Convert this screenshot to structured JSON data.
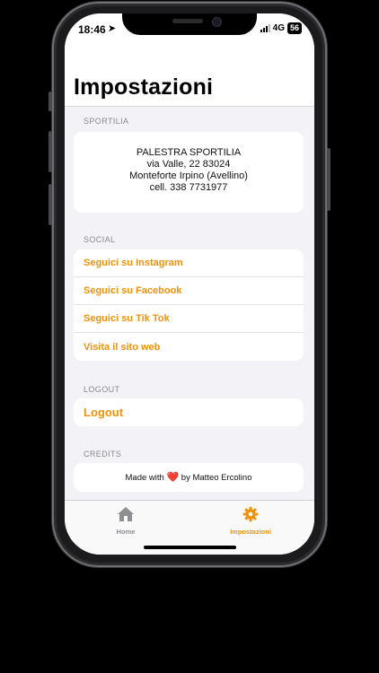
{
  "status": {
    "time": "18:46",
    "location_icon": "location-arrow-icon",
    "network": "4G",
    "battery": "56"
  },
  "page": {
    "title": "Impostazioni"
  },
  "sections": {
    "sportilia": {
      "header": "SPORTILIA",
      "lines": [
        "PALESTRA SPORTILIA",
        "via Valle, 22 83024",
        "Monteforte Irpino (Avellino)",
        "cell. 338 7731977"
      ]
    },
    "social": {
      "header": "SOCIAL",
      "items": [
        {
          "label": "Seguici su Instagram"
        },
        {
          "label": "Seguici su Facebook"
        },
        {
          "label": "Seguici su Tik Tok"
        },
        {
          "label": "Visita il sito web"
        }
      ]
    },
    "logout": {
      "header": "LOGOUT",
      "label": "Logout"
    },
    "credits": {
      "header": "CREDITS",
      "prefix": "Made with",
      "heart": "❤️",
      "suffix": "by Matteo Ercolino"
    }
  },
  "tabbar": {
    "tabs": [
      {
        "label": "Home",
        "icon": "home-icon",
        "color": "#8e8e93"
      },
      {
        "label": "Impostazioni",
        "icon": "gear-icon",
        "color": "#f0920b"
      }
    ]
  },
  "colors": {
    "accent": "#f0920b",
    "background": "#f2f2f7"
  }
}
